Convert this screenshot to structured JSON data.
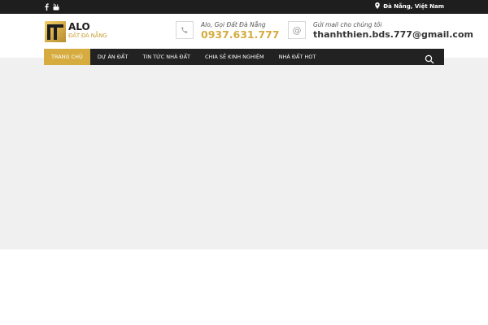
{
  "topbar": {
    "social": [
      "facebook-icon",
      "youtube-icon"
    ],
    "location": "Đà Nẵng, Việt Nam"
  },
  "logo": {
    "title": "ALO",
    "subtitle": "ĐẤT ĐÀ NẴNG"
  },
  "contact": {
    "phone_label": "Alo, Gọi Đất Đà Nẵng",
    "phone_value": "0937.631.777",
    "mail_label": "Gửi mail cho chúng tôi",
    "mail_value": "thanhthien.bds.777@gmail.com"
  },
  "nav": {
    "items": [
      "TRANG CHỦ",
      "DỰ ÁN ĐẤT",
      "TIN TỨC NHÀ ĐẤT",
      "CHIA SẺ KINH NGHIỆM",
      "NHÀ ĐẤT HOT"
    ],
    "active_index": 0
  },
  "colors": {
    "accent": "#d6ac40",
    "topbar": "#1e1e1e",
    "nav": "#222222",
    "content_bg": "#f0f0f0"
  }
}
